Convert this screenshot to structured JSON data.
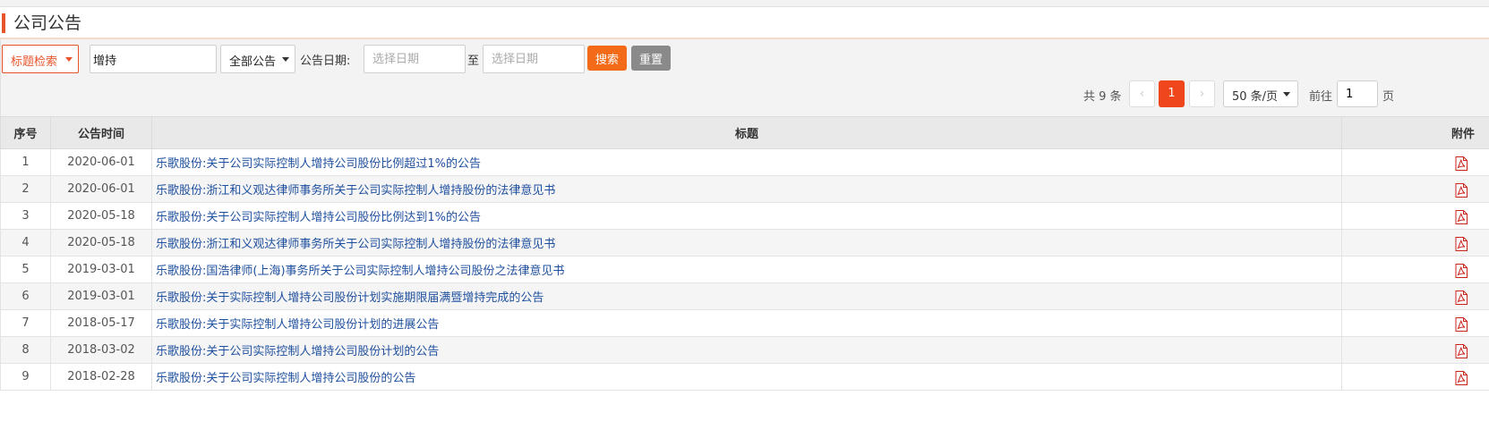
{
  "header": {
    "title": "公司公告"
  },
  "search": {
    "field_select": "标题检索",
    "keyword": "增持",
    "type_select": "全部公告",
    "date_label": "公告日期:",
    "date_from_placeholder": "选择日期",
    "date_sep": "至",
    "date_to_placeholder": "选择日期",
    "search_label": "搜索",
    "reset_label": "重置"
  },
  "pagination": {
    "total": "共 9 条",
    "prev": "‹",
    "current": "1",
    "next": "›",
    "page_size": "50 条/页",
    "goto_label": "前往",
    "goto_value": "1",
    "page_unit": "页"
  },
  "table": {
    "columns": [
      "序号",
      "公告时间",
      "标题",
      "附件"
    ],
    "rows": [
      {
        "no": "1",
        "date": "2020-06-01",
        "title": "乐歌股份:关于公司实际控制人增持公司股份比例超过1%的公告"
      },
      {
        "no": "2",
        "date": "2020-06-01",
        "title": "乐歌股份:浙江和义观达律师事务所关于公司实际控制人增持股份的法律意见书"
      },
      {
        "no": "3",
        "date": "2020-05-18",
        "title": "乐歌股份:关于公司实际控制人增持公司股份比例达到1%的公告"
      },
      {
        "no": "4",
        "date": "2020-05-18",
        "title": "乐歌股份:浙江和义观达律师事务所关于公司实际控制人增持股份的法律意见书"
      },
      {
        "no": "5",
        "date": "2019-03-01",
        "title": "乐歌股份:国浩律师(上海)事务所关于公司实际控制人增持公司股份之法律意见书"
      },
      {
        "no": "6",
        "date": "2019-03-01",
        "title": "乐歌股份:关于实际控制人增持公司股份计划实施期限届满暨增持完成的公告"
      },
      {
        "no": "7",
        "date": "2018-05-17",
        "title": "乐歌股份:关于实际控制人增持公司股份计划的进展公告"
      },
      {
        "no": "8",
        "date": "2018-03-02",
        "title": "乐歌股份:关于公司实际控制人增持公司股份计划的公告"
      },
      {
        "no": "9",
        "date": "2018-02-28",
        "title": "乐歌股份:关于公司实际控制人增持公司股份的公告"
      }
    ]
  },
  "icons": {
    "attachment": "pdf-icon"
  },
  "colors": {
    "accent": "#e8542a",
    "search_button": "#f36b19",
    "reset_button": "#8a8a8a",
    "page_current": "#f0461b",
    "link": "#1e4f9e"
  }
}
